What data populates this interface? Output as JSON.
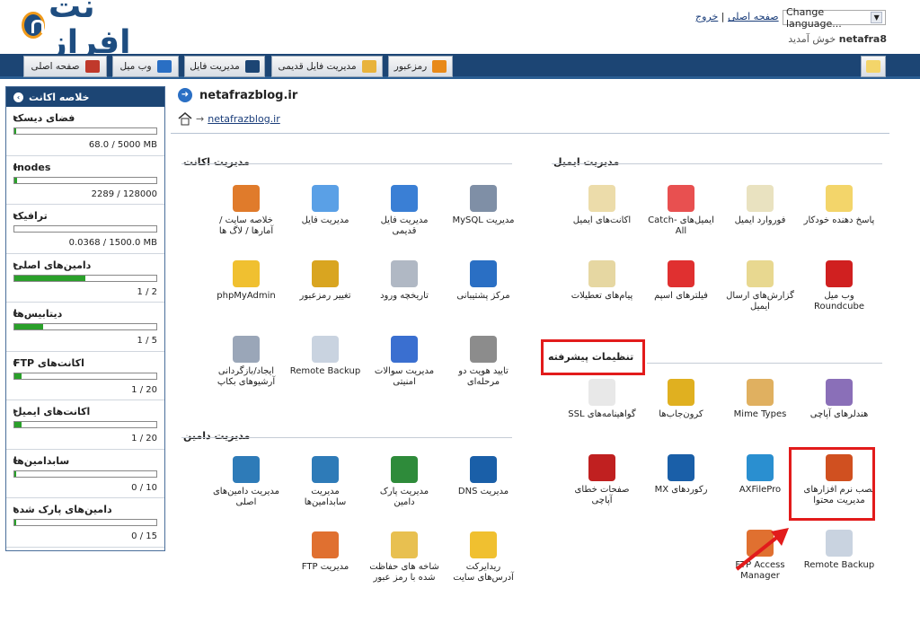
{
  "header": {
    "logo_text": "نت افراز",
    "home_link": "صفحه اصلی",
    "logout_link": "خروج",
    "separator": "|",
    "language_select": "Change language...",
    "welcome_user": "netafra8",
    "welcome_text": "خوش آمدید"
  },
  "nav": {
    "tabs": [
      {
        "label": "صفحه اصلی",
        "icon": "home-icon",
        "color": "#c0392b"
      },
      {
        "label": "وب میل",
        "icon": "mail-icon",
        "color": "#2a6fc4"
      },
      {
        "label": "مدیریت فایل",
        "icon": "file-manager-icon",
        "color": "#1c4574"
      },
      {
        "label": "مدیریت فایل قدیمی",
        "icon": "folder-icon",
        "color": "#e8b33c"
      },
      {
        "label": "رمزعبور",
        "icon": "password-icon",
        "color": "#e88a1a"
      }
    ],
    "email_icon": "envelope-icon"
  },
  "sidebar": {
    "title": "خلاصه اکانت",
    "stats": [
      {
        "label": "فضای دیسک",
        "value": "68.0 / 5000 MB",
        "fill": 0.01
      },
      {
        "label": "Inodes",
        "value": "2289 / 128000",
        "fill": 0.02
      },
      {
        "label": "ترافیک",
        "value": "0.0368 / 1500.0 MB",
        "fill": 0.0
      },
      {
        "label": "دامین‌های اصلی",
        "value": "1 / 2",
        "fill": 0.5
      },
      {
        "label": "دیتابیس‌ها",
        "value": "1 / 5",
        "fill": 0.2
      },
      {
        "label": "اکانت‌های FTP",
        "value": "1 / 20",
        "fill": 0.05
      },
      {
        "label": "اکانت‌های ایمیل",
        "value": "1 / 20",
        "fill": 0.05
      },
      {
        "label": "سابدامین‌ها",
        "value": "0 / 10",
        "fill": 0.0
      },
      {
        "label": "دامین‌های پارک شده",
        "value": "0 / 15",
        "fill": 0.0
      }
    ]
  },
  "main": {
    "title": "netafrazblog.ir",
    "breadcrumb": "netafrazblog.ir",
    "crumb_sep": "→",
    "sections": {
      "account": {
        "title": "مدیریت اکانت",
        "items": [
          {
            "label": "مدیریت MySQL",
            "icon": "database-icon"
          },
          {
            "label": "مدیریت فایل قدیمی",
            "icon": "file-manager-icon"
          },
          {
            "label": "مدیریت فایل",
            "icon": "file-manager-new-icon"
          },
          {
            "label": "خلاصه سایت / آمارها / لاگ ها",
            "icon": "stats-icon"
          },
          {
            "label": "مرکز پشتیبانی",
            "icon": "support-icon"
          },
          {
            "label": "تاریخچه ورود",
            "icon": "login-history-icon"
          },
          {
            "label": "تغییر رمزعبور",
            "icon": "lock-icon"
          },
          {
            "label": "phpMyAdmin",
            "icon": "phpmyadmin-icon"
          },
          {
            "label": "تایید هویت دو مرحله‌ای",
            "icon": "two-factor-icon"
          },
          {
            "label": "مدیریت سوالات امنیتی",
            "icon": "security-question-icon"
          },
          {
            "label": "Remote Backup",
            "icon": "remote-backup-icon"
          },
          {
            "label": "ایجاد/بازگردانی آرشیوهای بکاپ",
            "icon": "backup-icon"
          }
        ]
      },
      "email": {
        "title": "مدیریت ایمیل",
        "items": [
          {
            "label": "پاسخ دهنده خودکار",
            "icon": "autoresponder-icon"
          },
          {
            "label": "فوروارد ایمیل",
            "icon": "forward-icon"
          },
          {
            "label": "ایمیل‌های Catch-All",
            "icon": "catch-all-icon"
          },
          {
            "label": "اکانت‌های ایمیل",
            "icon": "email-accounts-icon"
          },
          {
            "label": "وب میل Roundcube",
            "icon": "roundcube-icon"
          },
          {
            "label": "گزارش‌های ارسال ایمیل",
            "icon": "delivery-report-icon"
          },
          {
            "label": "فیلترهای اسپم",
            "icon": "spam-filter-icon"
          },
          {
            "label": "پیام‌های تعطیلات",
            "icon": "vacation-icon"
          }
        ]
      },
      "advanced": {
        "title": "تنظیمات پیشرفته",
        "items": [
          {
            "label": "هندلرهای آپاچی",
            "icon": "handlers-icon"
          },
          {
            "label": "Mime Types",
            "icon": "mime-types-icon"
          },
          {
            "label": "کرون‌جاب‌ها",
            "icon": "cron-icon"
          },
          {
            "label": "گواهینامه‌های SSL",
            "icon": "ssl-certificate-icon"
          },
          {
            "label": "نصب نرم افزارهای مدیریت محتوا",
            "icon": "cms-installer-icon"
          },
          {
            "label": "AXFilePro",
            "icon": "axfilepro-icon"
          },
          {
            "label": "رکوردهای MX",
            "icon": "mx-records-icon"
          },
          {
            "label": "صفحات خطای آپاچی",
            "icon": "error-pages-icon"
          },
          {
            "label": "Remote Backup",
            "icon": "remote-backup-icon"
          },
          {
            "label": "FTP Access Manager",
            "icon": "ftp-access-icon"
          }
        ]
      },
      "domain": {
        "title": "مدیریت دامین",
        "items": [
          {
            "label": "مدیریت DNS",
            "icon": "dns-icon"
          },
          {
            "label": "مدیریت پارک دامین",
            "icon": "parked-domain-icon"
          },
          {
            "label": "مدیریت سابدامین‌ها",
            "icon": "subdomain-icon"
          },
          {
            "label": "مدیریت دامین‌های اصلی",
            "icon": "domain-icon"
          },
          {
            "label": "ریدایرکت آدرس‌های سایت",
            "icon": "redirect-icon"
          },
          {
            "label": "شاخه های حفاظت شده با رمز عبور",
            "icon": "protected-folder-icon"
          },
          {
            "label": "مدیریت FTP",
            "icon": "ftp-icon"
          }
        ]
      }
    }
  },
  "colors": {
    "nav_bg": "#1c4574",
    "highlight": "#e21b1b",
    "bar_fill": "#2aa02a"
  }
}
